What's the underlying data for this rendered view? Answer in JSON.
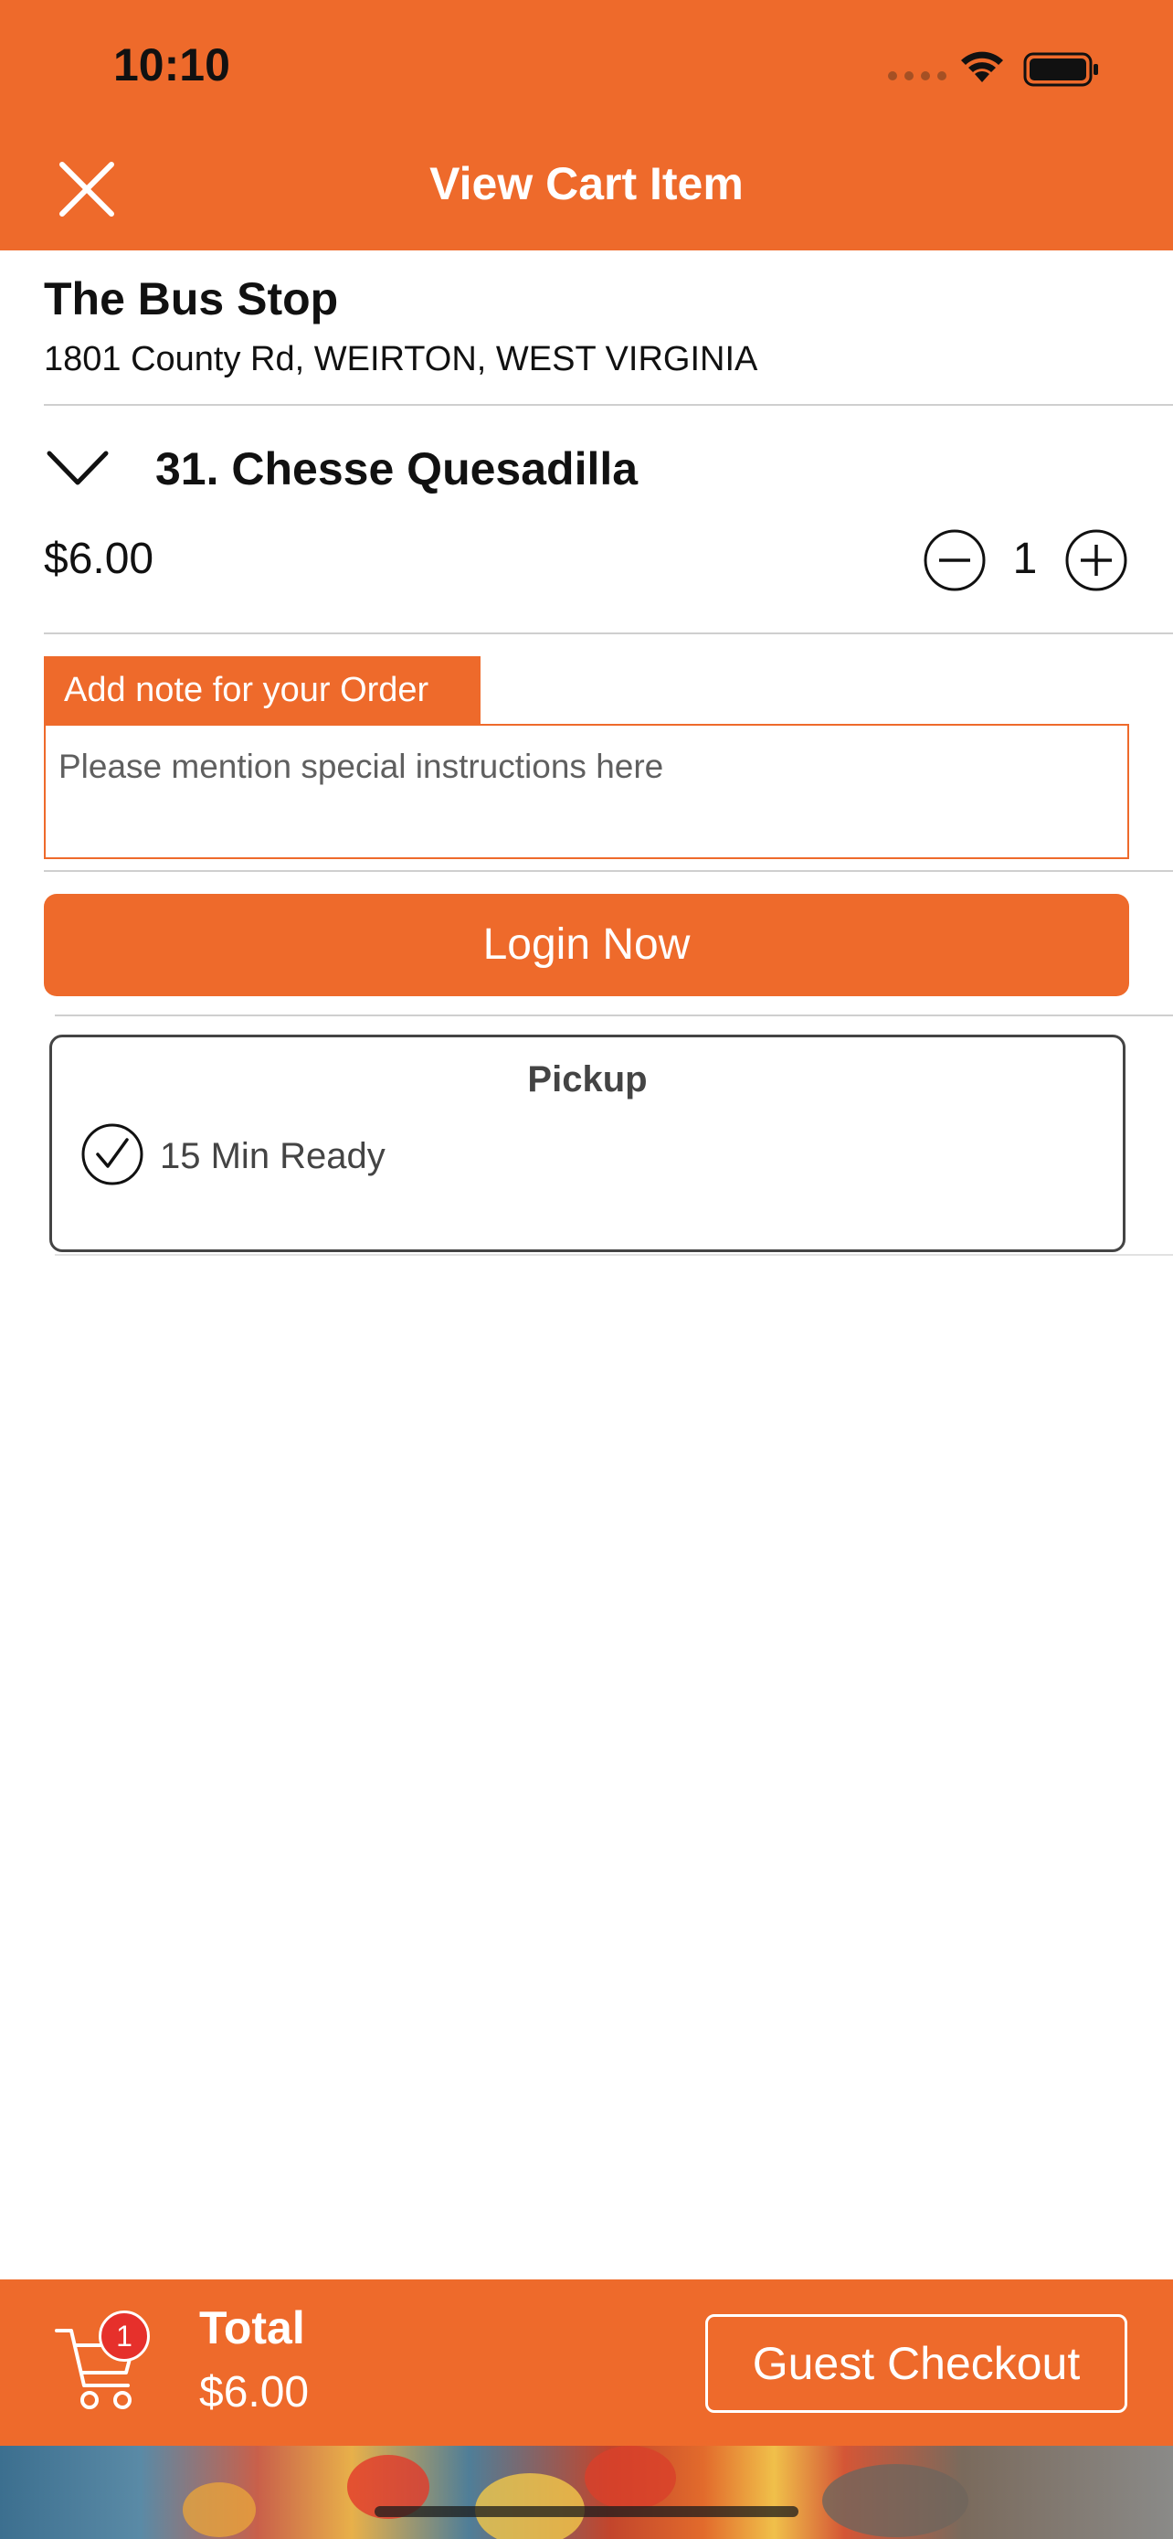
{
  "status_bar": {
    "time": "10:10"
  },
  "header": {
    "title": "View Cart Item",
    "close_icon": "close-icon"
  },
  "store": {
    "name": "The Bus Stop",
    "address": "1801 County Rd, WEIRTON, WEST VIRGINIA"
  },
  "item": {
    "name": "31. Chesse Quesadilla",
    "price": "$6.00",
    "quantity": "1"
  },
  "note": {
    "label": "Add note for your Order",
    "placeholder": "Please mention special instructions here",
    "value": ""
  },
  "login_button": "Login Now",
  "pickup": {
    "title": "Pickup",
    "option": "15 Min Ready",
    "selected": true
  },
  "footer": {
    "cart_count": "1",
    "total_label": "Total",
    "total_value": "$6.00",
    "guest_checkout": "Guest Checkout"
  },
  "colors": {
    "accent": "#ee6a2b",
    "badge": "#e6302b",
    "text": "#111111"
  }
}
